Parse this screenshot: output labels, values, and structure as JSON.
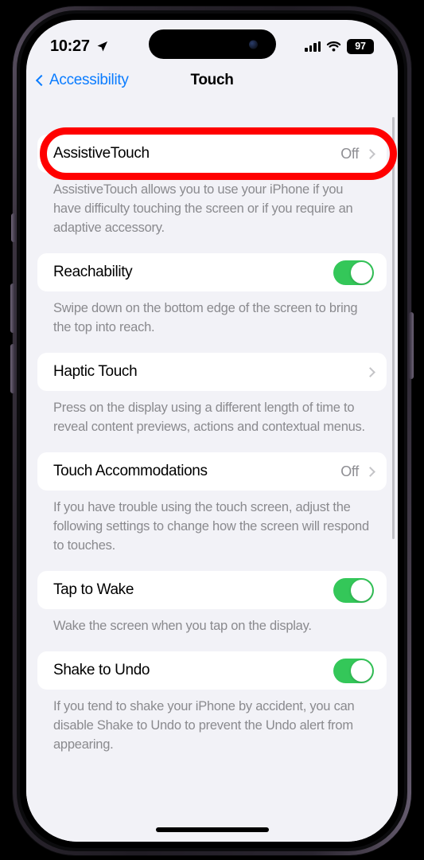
{
  "status_bar": {
    "time": "10:27",
    "location_icon": "location-arrow-icon",
    "signal_icon": "cellular-signal-icon",
    "wifi_icon": "wifi-icon",
    "battery_percent": "97"
  },
  "nav": {
    "back_label": "Accessibility",
    "back_icon": "chevron-left-icon",
    "title": "Touch"
  },
  "groups": [
    {
      "label": "AssistiveTouch",
      "value": "Off",
      "accessory": "chevron",
      "highlighted": true,
      "footer": "AssistiveTouch allows you to use your iPhone if you have difficulty touching the screen or if you require an adaptive accessory."
    },
    {
      "label": "Reachability",
      "value": "",
      "accessory": "toggle-on",
      "highlighted": false,
      "footer": "Swipe down on the bottom edge of the screen to bring the top into reach."
    },
    {
      "label": "Haptic Touch",
      "value": "",
      "accessory": "chevron",
      "highlighted": false,
      "footer": "Press on the display using a different length of time to reveal content previews, actions and contextual menus."
    },
    {
      "label": "Touch Accommodations",
      "value": "Off",
      "accessory": "chevron",
      "highlighted": false,
      "footer": "If you have trouble using the touch screen, adjust the following settings to change how the screen will respond to touches."
    },
    {
      "label": "Tap to Wake",
      "value": "",
      "accessory": "toggle-on",
      "highlighted": false,
      "footer": "Wake the screen when you tap on the display."
    },
    {
      "label": "Shake to Undo",
      "value": "",
      "accessory": "toggle-on",
      "highlighted": false,
      "footer": "If you tend to shake your iPhone by accident, you can disable Shake to Undo to prevent the Undo alert from appearing."
    }
  ],
  "colors": {
    "accent_blue": "#0a7cff",
    "toggle_green": "#34c759",
    "annotation_red": "#ff0000",
    "background": "#f2f2f7"
  }
}
